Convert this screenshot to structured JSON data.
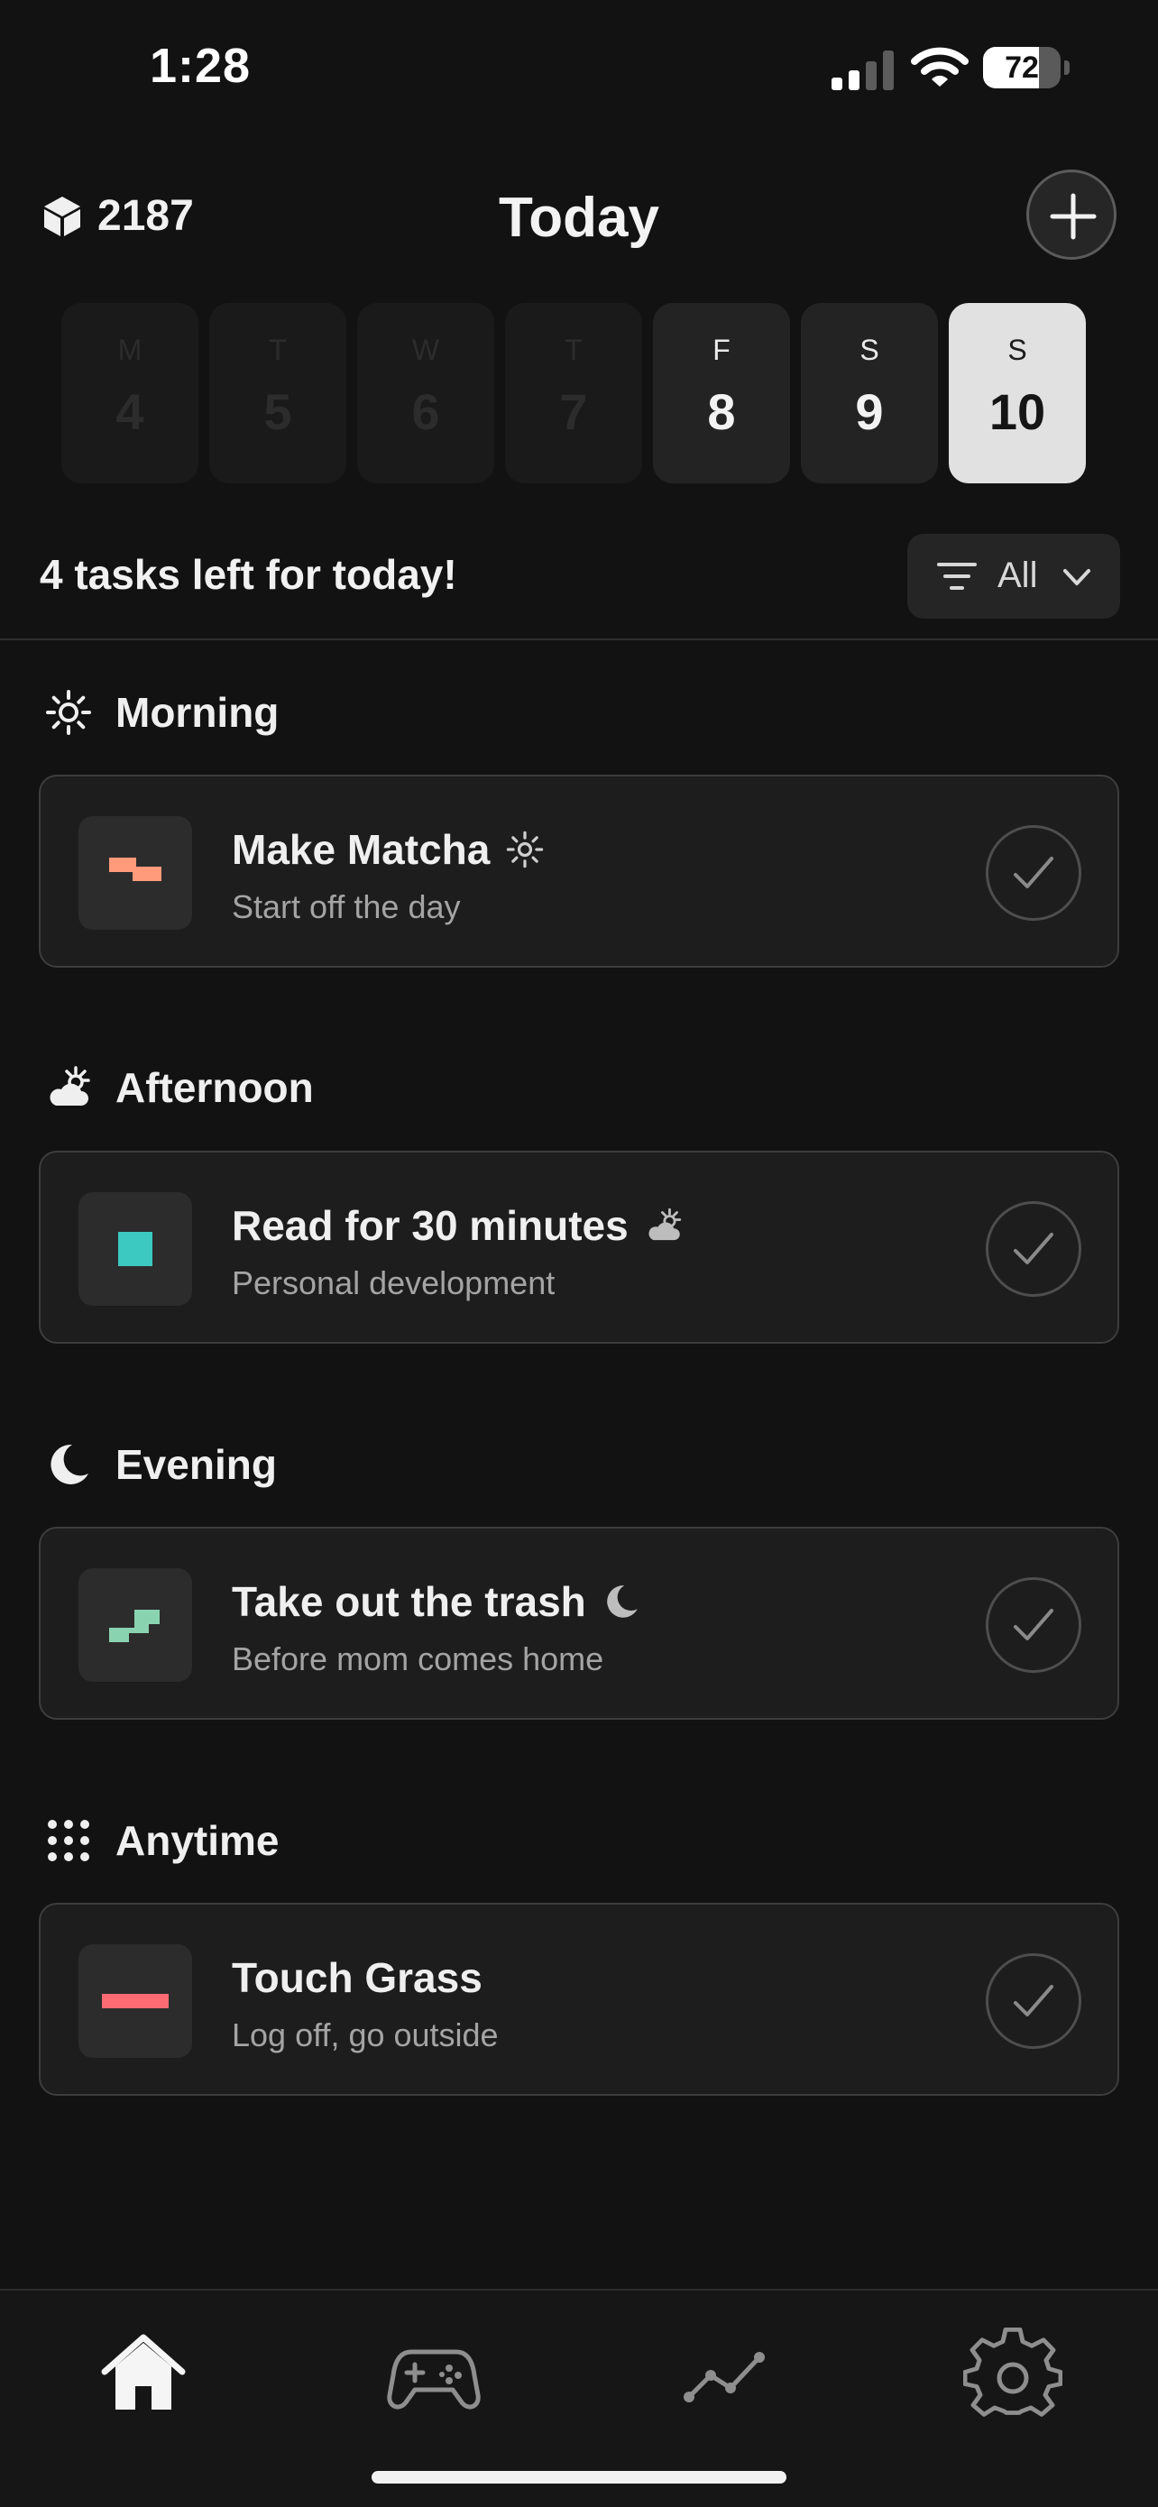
{
  "status_bar": {
    "time": "1:28",
    "battery_level": "72",
    "battery_fraction": 0.72
  },
  "header": {
    "points": "2187",
    "title": "Today"
  },
  "days": [
    {
      "letter": "M",
      "number": "4",
      "state": "past"
    },
    {
      "letter": "T",
      "number": "5",
      "state": "past"
    },
    {
      "letter": "W",
      "number": "6",
      "state": "past"
    },
    {
      "letter": "T",
      "number": "7",
      "state": "past"
    },
    {
      "letter": "F",
      "number": "8",
      "state": "active"
    },
    {
      "letter": "S",
      "number": "9",
      "state": "active"
    },
    {
      "letter": "S",
      "number": "10",
      "state": "selected"
    }
  ],
  "summary": {
    "text": "4 tasks left for today!"
  },
  "filter": {
    "label": "All"
  },
  "sections": [
    {
      "name": "Morning",
      "icon": "sun-icon",
      "task": {
        "title": "Make Matcha",
        "subtitle": "Start off the day",
        "icon": "stairs-shape-icon",
        "color": "#ff9a7b",
        "time_icon": "sun-icon"
      }
    },
    {
      "name": "Afternoon",
      "icon": "cloud-sun-icon",
      "task": {
        "title": "Read for 30 minutes",
        "subtitle": "Personal development",
        "icon": "square-shape-icon",
        "color": "#3cc9c2",
        "time_icon": "cloud-sun-icon"
      }
    },
    {
      "name": "Evening",
      "icon": "moon-icon",
      "task": {
        "title": "Take out the trash",
        "subtitle": "Before mom comes home",
        "icon": "steps-shape-icon",
        "color": "#8ad3b0",
        "time_icon": "moon-icon"
      }
    },
    {
      "name": "Anytime",
      "icon": "grid-dots-icon",
      "task": {
        "title": "Touch Grass",
        "subtitle": "Log off, go outside",
        "icon": "bar-shape-icon",
        "color": "#ff6b72",
        "time_icon": ""
      }
    }
  ],
  "tabs": [
    {
      "name": "Home",
      "icon": "home-icon",
      "active": true
    },
    {
      "name": "Games",
      "icon": "gamepad-icon",
      "active": false
    },
    {
      "name": "Stats",
      "icon": "trend-icon",
      "active": false
    },
    {
      "name": "Settings",
      "icon": "gear-icon",
      "active": false
    }
  ]
}
